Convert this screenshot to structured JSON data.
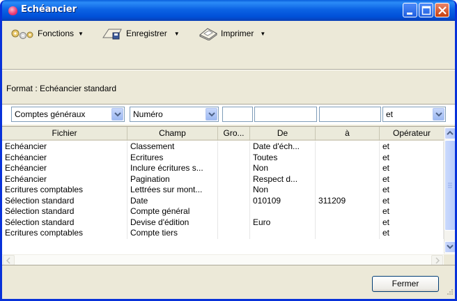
{
  "window": {
    "title": "Echéancier"
  },
  "toolbar": {
    "functions_label": "Fonctions",
    "save_label": "Enregistrer",
    "print_label": "Imprimer"
  },
  "format": {
    "label": "Format : Echéancier standard"
  },
  "filters": {
    "account_type": "Comptes généraux",
    "sort_field": "Numéro",
    "from": "",
    "to": "",
    "extra": "",
    "operator": "et"
  },
  "table": {
    "columns": [
      "Fichier",
      "Champ",
      "Gro...",
      "De",
      "à",
      "Opérateur"
    ],
    "rows": [
      [
        "Echéancier",
        "Classement",
        "",
        "Date d'éch...",
        "",
        "et"
      ],
      [
        "Echéancier",
        "Ecritures",
        "",
        "Toutes",
        "",
        "et"
      ],
      [
        "Echéancier",
        "Inclure écritures s...",
        "",
        "Non",
        "",
        "et"
      ],
      [
        "Echéancier",
        "Pagination",
        "",
        "Respect d...",
        "",
        "et"
      ],
      [
        "Ecritures comptables",
        "Lettrées sur mont...",
        "",
        "Non",
        "",
        "et"
      ],
      [
        "Sélection standard",
        "Date",
        "",
        "010109",
        "311209",
        "et"
      ],
      [
        "Sélection standard",
        "Compte général",
        "",
        "",
        "",
        "et"
      ],
      [
        "Sélection standard",
        "Devise d'édition",
        "",
        "Euro",
        "",
        "et"
      ],
      [
        "Ecritures comptables",
        "Compte tiers",
        "",
        "",
        "",
        "et"
      ]
    ]
  },
  "footer": {
    "close_label": "Fermer"
  },
  "colors": {
    "title_bar": "#0054e3",
    "window_bg": "#ece9d8",
    "close_button": "#c7400e"
  }
}
